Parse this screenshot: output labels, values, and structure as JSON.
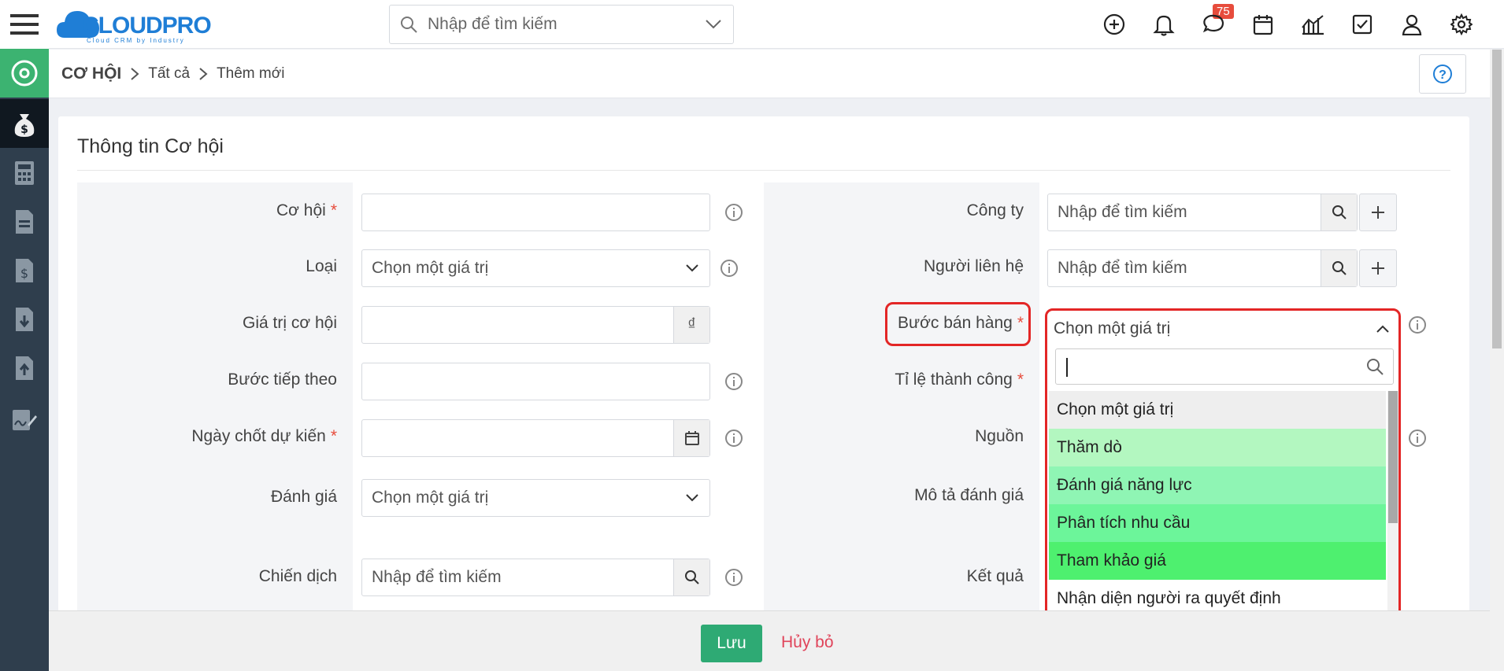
{
  "brand": {
    "name": "CLOUDPRO",
    "tagline": "Cloud CRM by Industry"
  },
  "header": {
    "search_placeholder": "Nhập để tìm kiếm",
    "notification_count": "75"
  },
  "breadcrumb": {
    "root": "CƠ HỘI",
    "level1": "Tất cả",
    "level2": "Thêm mới"
  },
  "form": {
    "title": "Thông tin Cơ hội",
    "left": {
      "opportunity": {
        "label": "Cơ hội",
        "required": "*"
      },
      "type": {
        "label": "Loại",
        "value": "Chọn một giá trị"
      },
      "amount": {
        "label": "Giá trị cơ hội",
        "currency": "₫"
      },
      "next_step": {
        "label": "Bước tiếp theo"
      },
      "close_date": {
        "label": "Ngày chốt dự kiến",
        "required": "*"
      },
      "rating": {
        "label": "Đánh giá",
        "value": "Chọn một giá trị"
      },
      "campaign": {
        "label": "Chiến dịch",
        "placeholder": "Nhập để tìm kiếm"
      }
    },
    "right": {
      "company": {
        "label": "Công ty",
        "placeholder": "Nhập để tìm kiếm"
      },
      "contact": {
        "label": "Người liên hệ",
        "placeholder": "Nhập để tìm kiếm"
      },
      "sales_stage": {
        "label": "Bước bán hàng",
        "required": "*",
        "value": "Chọn một giá trị"
      },
      "probability": {
        "label": "Tỉ lệ thành công",
        "required": "*"
      },
      "source": {
        "label": "Nguồn"
      },
      "rating_desc": {
        "label": "Mô tả đánh giá"
      },
      "result": {
        "label": "Kết quả"
      }
    }
  },
  "dropdown": {
    "options": [
      {
        "label": "Chọn một giá trị",
        "color": "#eeeeee"
      },
      {
        "label": "Thăm dò",
        "color": "#b3f7c0"
      },
      {
        "label": "Đánh giá năng lực",
        "color": "#8ff5b4"
      },
      {
        "label": "Phân tích nhu cầu",
        "color": "#6cf59a"
      },
      {
        "label": "Tham khảo giá",
        "color": "#4ef06f"
      },
      {
        "label": "Nhận diện người ra quyết định",
        "color": "#ffffff"
      },
      {
        "label": "",
        "color": "#22e85a"
      }
    ]
  },
  "footer": {
    "save": "Lưu",
    "cancel": "Hủy bỏ"
  },
  "colors": {
    "sidebar": "#2f3e4d",
    "accent_green": "#2eaa74",
    "highlight_red": "#e32626"
  }
}
